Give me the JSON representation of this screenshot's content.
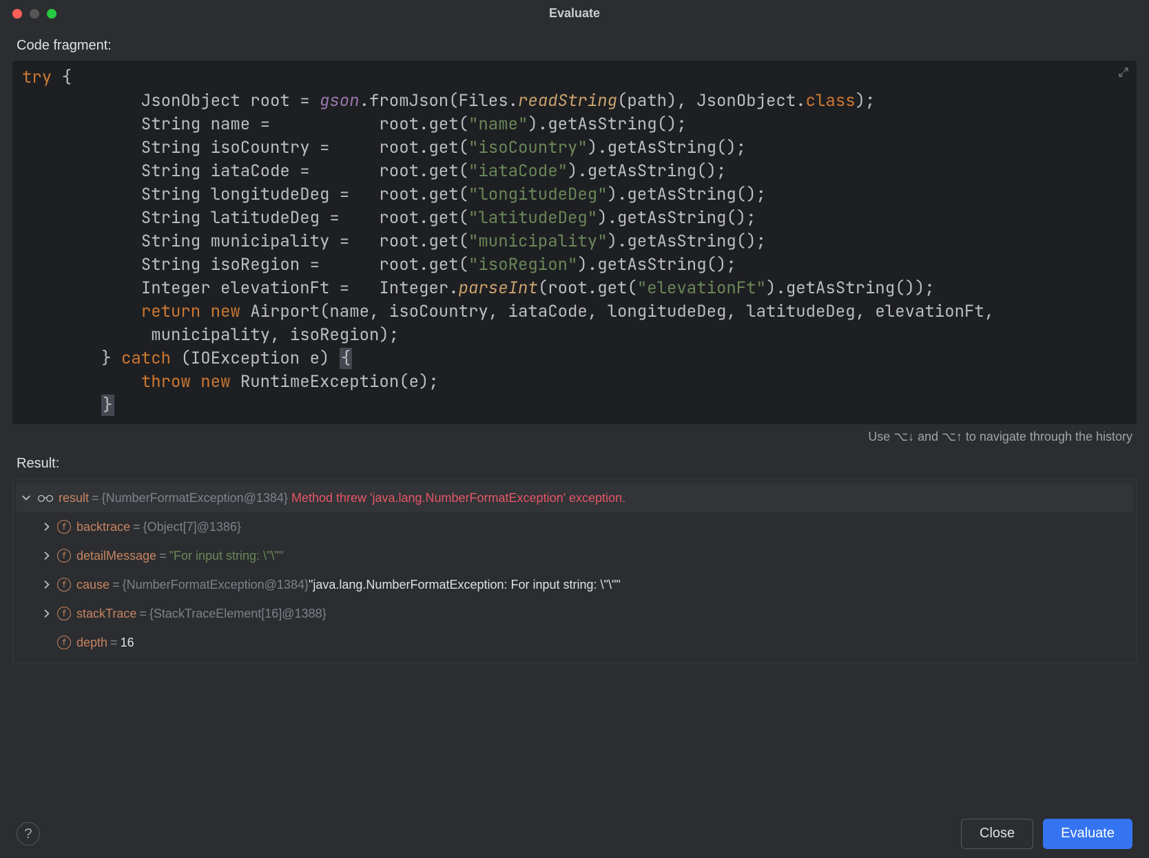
{
  "title": "Evaluate",
  "labels": {
    "code_fragment": "Code fragment:",
    "result": "Result:",
    "hint": "Use ⌥↓  and  ⌥↑  to navigate through the history"
  },
  "code": {
    "lines": [
      [
        {
          "t": "try",
          "c": "kw"
        },
        {
          "t": " {"
        }
      ],
      [
        {
          "t": "            JsonObject root = "
        },
        {
          "t": "gson",
          "c": "fld"
        },
        {
          "t": ".fromJson(Files."
        },
        {
          "t": "readString",
          "c": "stc"
        },
        {
          "t": "(path), JsonObject."
        },
        {
          "t": "class",
          "c": "kw"
        },
        {
          "t": ");"
        }
      ],
      [
        {
          "t": "            String name =           root.get("
        },
        {
          "t": "\"name\"",
          "c": "str"
        },
        {
          "t": ").getAsString();"
        }
      ],
      [
        {
          "t": "            String isoCountry =     root.get("
        },
        {
          "t": "\"isoCountry\"",
          "c": "str"
        },
        {
          "t": ").getAsString();"
        }
      ],
      [
        {
          "t": "            String iataCode =       root.get("
        },
        {
          "t": "\"iataCode\"",
          "c": "str"
        },
        {
          "t": ").getAsString();"
        }
      ],
      [
        {
          "t": "            String longitudeDeg =   root.get("
        },
        {
          "t": "\"longitudeDeg\"",
          "c": "str"
        },
        {
          "t": ").getAsString();"
        }
      ],
      [
        {
          "t": "            String latitudeDeg =    root.get("
        },
        {
          "t": "\"latitudeDeg\"",
          "c": "str"
        },
        {
          "t": ").getAsString();"
        }
      ],
      [
        {
          "t": "            String municipality =   root.get("
        },
        {
          "t": "\"municipality\"",
          "c": "str"
        },
        {
          "t": ").getAsString();"
        }
      ],
      [
        {
          "t": "            String isoRegion =      root.get("
        },
        {
          "t": "\"isoRegion\"",
          "c": "str"
        },
        {
          "t": ").getAsString();"
        }
      ],
      [
        {
          "t": "            Integer elevationFt =   Integer."
        },
        {
          "t": "parseInt",
          "c": "stc"
        },
        {
          "t": "(root.get("
        },
        {
          "t": "\"elevationFt\"",
          "c": "str"
        },
        {
          "t": ").getAsString());"
        }
      ],
      [
        {
          "t": "            "
        },
        {
          "t": "return new",
          "c": "kw"
        },
        {
          "t": " Airport(name, isoCountry, iataCode, longitudeDeg, latitudeDeg, elevationFt,"
        }
      ],
      [
        {
          "t": "             municipality, isoRegion);"
        }
      ],
      [
        {
          "t": "        } "
        },
        {
          "t": "catch",
          "c": "kw"
        },
        {
          "t": " (IOException e) {",
          "wrap": "open"
        }
      ],
      [
        {
          "t": "            "
        },
        {
          "t": "throw new",
          "c": "kw"
        },
        {
          "t": " RuntimeException(e);"
        }
      ],
      [
        {
          "t": "        }",
          "wrap": "close"
        }
      ]
    ]
  },
  "result": {
    "root": {
      "name": "result",
      "type": "{NumberFormatException@1384}",
      "message": "Method threw 'java.lang.NumberFormatException' exception."
    },
    "children": [
      {
        "badge": "f",
        "name": "backtrace",
        "eq": "=",
        "val": "{Object[7]@1386}",
        "valClass": "dimv",
        "expandable": true
      },
      {
        "badge": "f",
        "name": "detailMessage",
        "eq": "=",
        "val": "\"For input string: \\\"\\\"\"",
        "valClass": "strv",
        "expandable": true
      },
      {
        "badge": "f",
        "recursive": true,
        "name": "cause",
        "eq": "=",
        "val": "{NumberFormatException@1384}",
        "valClass": "dimv",
        "tail": " \"java.lang.NumberFormatException: For input string: \\\"\\\"\"",
        "expandable": true
      },
      {
        "badge": "f",
        "name": "stackTrace",
        "eq": "=",
        "val": "{StackTraceElement[16]@1388}",
        "valClass": "dimv",
        "expandable": true
      },
      {
        "badge": "f",
        "name": "depth",
        "eq": "=",
        "val": "16",
        "valClass": "whitev",
        "expandable": false
      }
    ]
  },
  "buttons": {
    "close": "Close",
    "evaluate": "Evaluate"
  }
}
